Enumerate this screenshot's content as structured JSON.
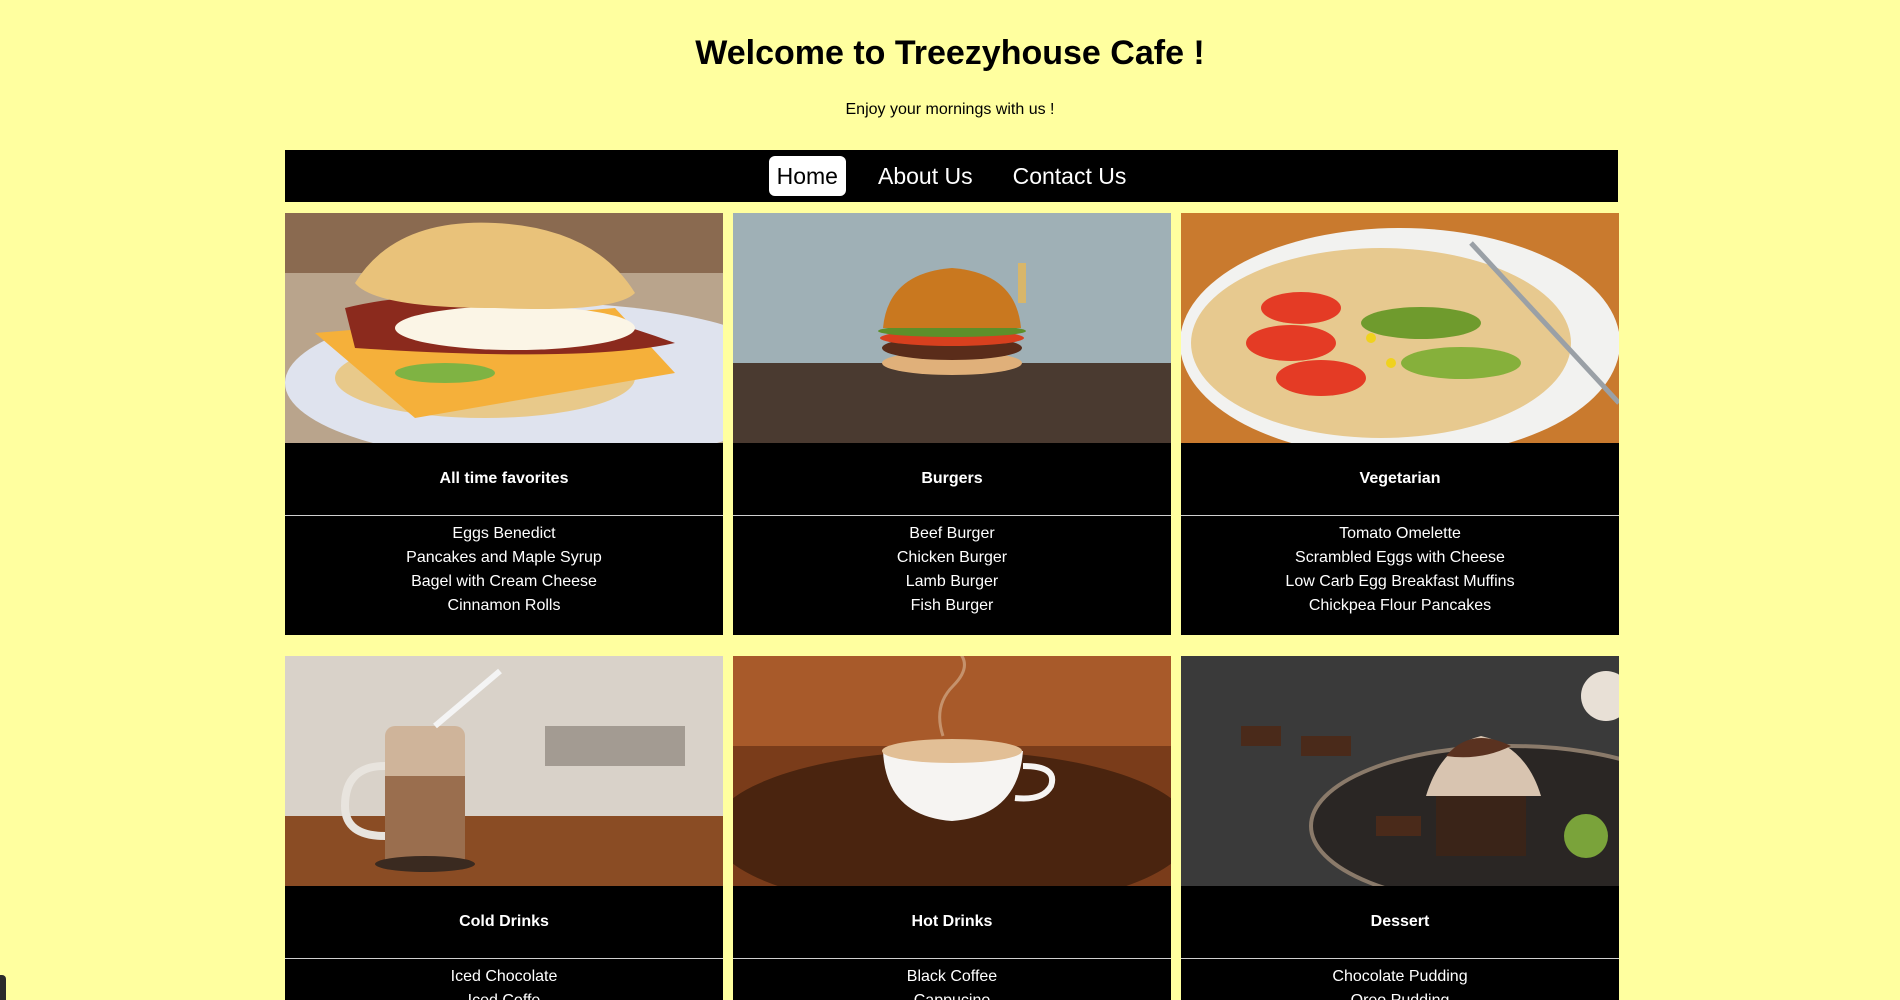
{
  "header": {
    "title": "Welcome to Treezyhouse Cafe !",
    "subtitle": "Enjoy your mornings with us !"
  },
  "nav": {
    "items": [
      {
        "label": "Home",
        "active": true
      },
      {
        "label": "About Us",
        "active": false
      },
      {
        "label": "Contact Us",
        "active": false
      }
    ]
  },
  "menu": {
    "cards": [
      {
        "title": "All time favorites",
        "image": "breakfast-sandwich-photo",
        "items": [
          "Eggs Benedict",
          "Pancakes and Maple Syrup",
          "Bagel with Cream Cheese",
          "Cinnamon Rolls"
        ]
      },
      {
        "title": "Burgers",
        "image": "burger-photo",
        "items": [
          "Beef Burger",
          "Chicken Burger",
          "Lamb Burger",
          "Fish Burger"
        ]
      },
      {
        "title": "Vegetarian",
        "image": "vegetable-flatbread-photo",
        "items": [
          "Tomato Omelette",
          "Scrambled Eggs with Cheese",
          "Low Carb Egg Breakfast Muffins",
          "Chickpea Flour Pancakes"
        ]
      },
      {
        "title": "Cold Drinks",
        "image": "iced-drink-jar-photo",
        "items": [
          "Iced Chocolate",
          "Iced Coffe"
        ]
      },
      {
        "title": "Hot Drinks",
        "image": "coffee-cup-beans-photo",
        "items": [
          "Black Coffee",
          "Cappucino"
        ]
      },
      {
        "title": "Dessert",
        "image": "chocolate-cupcake-photo",
        "items": [
          "Chocolate Pudding",
          "Oreo Pudding"
        ]
      }
    ]
  },
  "colors": {
    "page_background": "#ffff9f",
    "nav_background": "#000000",
    "card_background": "#000000",
    "active_nav_background": "#ffffff"
  }
}
